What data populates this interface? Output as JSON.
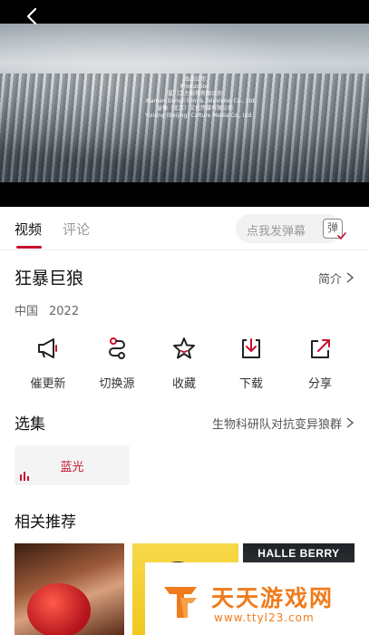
{
  "player": {
    "credits": [
      "出品公司",
      "Production",
      "厦门工力影视有限公司",
      "Xiamen Gongli Film & Television Co., Ltd.",
      "益像（北京）文化传媒有限公司",
      "Yixiang (Beijing) Culture Media Co., Ltd."
    ],
    "back_icon": "chevron-left-icon"
  },
  "tabs": [
    {
      "label": "视频",
      "active": true
    },
    {
      "label": "评论",
      "active": false
    }
  ],
  "danmaku": {
    "placeholder": "点我发弹幕",
    "toggle_label": "弹"
  },
  "movie": {
    "title": "狂暴巨狼",
    "intro_label": "简介",
    "region": "中国",
    "year": "2022"
  },
  "actions": [
    {
      "label": "催更新",
      "icon": "megaphone-icon"
    },
    {
      "label": "切换源",
      "icon": "switch-source-icon"
    },
    {
      "label": "收藏",
      "icon": "star-icon"
    },
    {
      "label": "下载",
      "icon": "download-icon"
    },
    {
      "label": "分享",
      "icon": "share-icon"
    }
  ],
  "episodes": {
    "title": "选集",
    "description": "生物科研队对抗变异狼群",
    "items": [
      {
        "label": "蓝光",
        "playing": true
      }
    ]
  },
  "related": {
    "title": "相关推荐",
    "posters": [
      {
        "text": ""
      },
      {
        "text": ""
      },
      {
        "text": "HALLE BERRY"
      }
    ]
  },
  "watermark": {
    "title": "天天游戏网",
    "url": "www.ttyl23.com"
  },
  "colors": {
    "accent": "#c8102e",
    "watermark": "#f07b1c"
  }
}
